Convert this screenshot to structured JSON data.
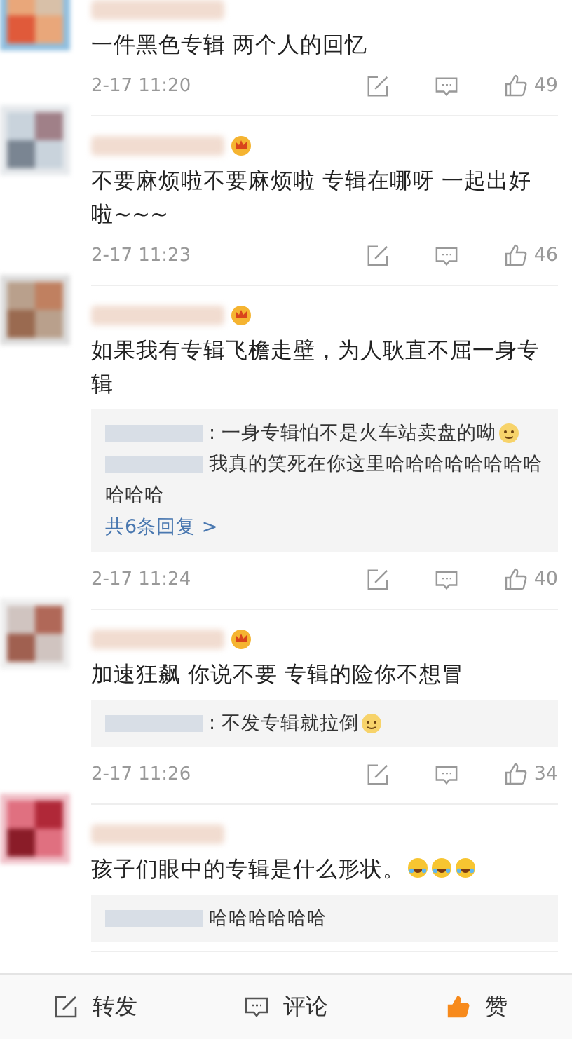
{
  "comments": [
    {
      "vip": false,
      "text": "一件黑色专辑 两个人的回忆",
      "time": "2-17 11:20",
      "likes": "49"
    },
    {
      "vip": true,
      "text": "不要麻烦啦不要麻烦啦 专辑在哪呀 一起出好啦~~~",
      "time": "2-17 11:23",
      "likes": "46"
    },
    {
      "vip": true,
      "text": "如果我有专辑飞檐走壁，为人耿直不屈一身专辑",
      "time": "2-17 11:24",
      "likes": "40",
      "replies": [
        {
          "text": ": 一身专辑怕不是火车站卖盘的呦",
          "emoji": true
        },
        {
          "text": "我真的笑死在你这里哈哈哈哈哈哈哈哈哈哈哈",
          "emoji": false
        }
      ],
      "more": "共6条回复 >"
    },
    {
      "vip": true,
      "text": "加速狂飙 你说不要 专辑的险你不想冒",
      "time": "2-17 11:26",
      "likes": "34",
      "replies": [
        {
          "text": ": 不发专辑就拉倒",
          "emoji": true
        }
      ]
    },
    {
      "vip": false,
      "text": "孩子们眼中的专辑是什么形状。",
      "replies": [
        {
          "text": "哈哈哈哈哈哈",
          "emoji": false
        }
      ],
      "emojis": [
        {
          "kind": "laugh"
        },
        {
          "kind": "laugh"
        },
        {
          "kind": "laugh"
        }
      ]
    }
  ],
  "bottom_bar": [
    {
      "kind": "repost",
      "label": "转发"
    },
    {
      "kind": "comment",
      "label": "评论"
    },
    {
      "kind": "like",
      "label": "赞",
      "liked": true
    }
  ]
}
